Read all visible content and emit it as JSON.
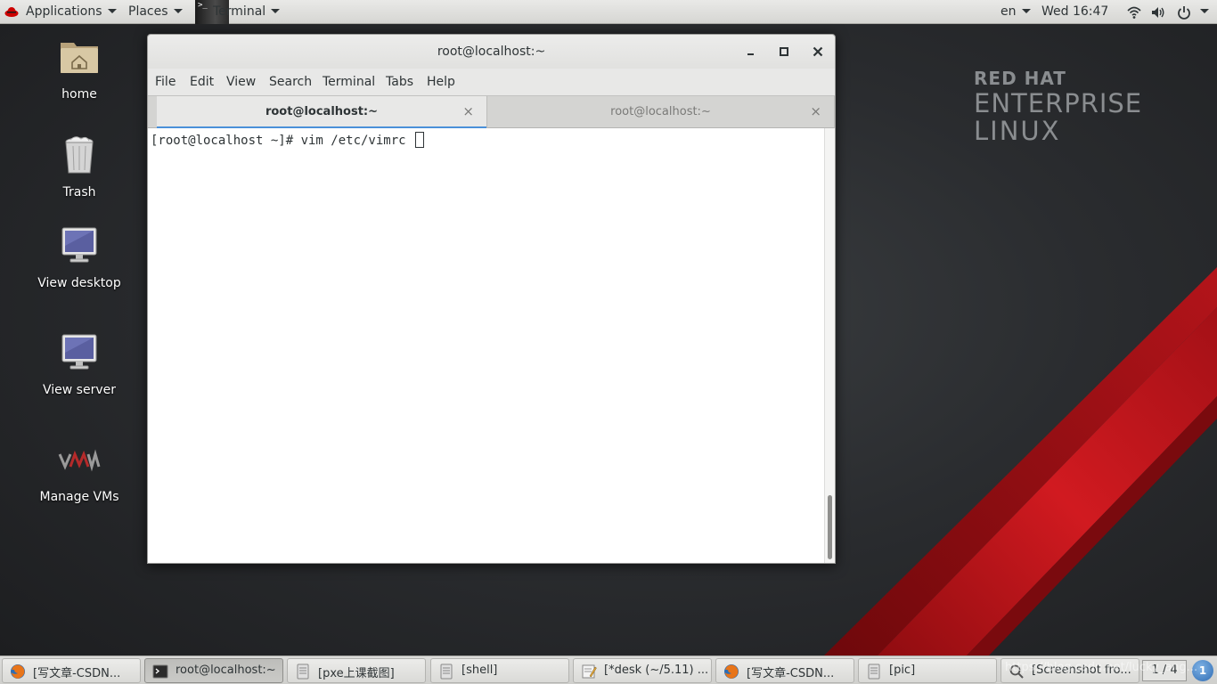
{
  "topbar": {
    "applications": "Applications",
    "places": "Places",
    "terminal": "Terminal",
    "terminal_thumb_glyph": ">_",
    "language": "en",
    "clock": "Wed 16:47",
    "icons": [
      "redhat-icon",
      "wifi-icon",
      "volume-icon",
      "power-icon"
    ]
  },
  "desktop": {
    "icons": [
      {
        "label": "home",
        "icon": "home-folder-icon"
      },
      {
        "label": "Trash",
        "icon": "trash-icon"
      },
      {
        "label": "View desktop",
        "icon": "monitor-icon"
      },
      {
        "label": "View server",
        "icon": "monitor-icon"
      },
      {
        "label": "Manage VMs",
        "icon": "vm-logo-icon"
      }
    ]
  },
  "wallpaper": {
    "logo_line1": "RED HAT",
    "logo_line2": "ENTERPRISE",
    "logo_line3": "LINUX",
    "stripe_color": "#c4161c"
  },
  "window": {
    "title": "root@localhost:~",
    "menu": [
      "File",
      "Edit",
      "View",
      "Search",
      "Terminal",
      "Tabs",
      "Help"
    ],
    "tabs": [
      {
        "label": "root@localhost:~",
        "active": true
      },
      {
        "label": "root@localhost:~",
        "active": false
      }
    ],
    "close_glyph": "×",
    "prompt": "[root@localhost ~]# vim /etc/vimrc "
  },
  "taskbar": {
    "items": [
      {
        "label": "[写文章-CSDN...",
        "icon": "firefox-icon",
        "active": false
      },
      {
        "label": "root@localhost:~",
        "icon": "terminal-icon",
        "active": true
      },
      {
        "label": "[pxe上课截图]",
        "icon": "file-manager-icon",
        "active": false
      },
      {
        "label": "[shell]",
        "icon": "file-manager-icon",
        "active": false
      },
      {
        "label": "[*desk (~/5.11) ...",
        "icon": "text-editor-icon",
        "active": false
      },
      {
        "label": "[写文章-CSDN...",
        "icon": "firefox-icon",
        "active": false
      },
      {
        "label": "[pic]",
        "icon": "file-manager-icon",
        "active": false
      },
      {
        "label": "[Screenshot fro...",
        "icon": "screenshot-icon",
        "active": false
      }
    ],
    "pager": "1 / 4",
    "notification_count": "1",
    "watermark": "https://blog.csdn.net/lucky_ang..."
  },
  "colors": {
    "accent": "#4a90d9",
    "panel": "#e8e8e7",
    "stripe_red": "#c4161c"
  }
}
